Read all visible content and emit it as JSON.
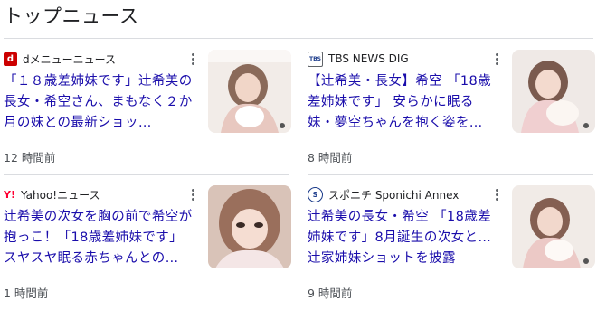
{
  "section": {
    "title": "トップニュース"
  },
  "colors": {
    "link": "#1a0dab",
    "meta": "#4d5156",
    "divider": "#dadce0"
  },
  "cards": [
    {
      "source": "dメニューニュース",
      "logo_text": "d",
      "logo_icon": "d-menu-logo-icon",
      "title": "「１８歳差姉妹です」辻希美の長女・希空さん、まもなく２か月の妹との最新ショッ…",
      "time": "12 時間前"
    },
    {
      "source": "TBS NEWS DIG",
      "logo_text": "TBS",
      "logo_icon": "tbs-logo-icon",
      "title": "【辻希美・長女】希空 「18歳差姉妹です」 安らかに眠る妹・夢空ちゃんを抱く姿を…",
      "time": "8 時間前"
    },
    {
      "source": "Yahoo!ニュース",
      "logo_text": "Y!",
      "logo_icon": "yahoo-logo-icon",
      "title": "辻希美の次女を胸の前で希空が抱っこ！「18歳差姉妹です」スヤスヤ眠る赤ちゃんとの…",
      "time": "1 時間前"
    },
    {
      "source": "スポニチ Sponichi Annex",
      "logo_text": "S",
      "logo_icon": "sponichi-logo-icon",
      "title": "辻希美の長女・希空 「18歳差姉妹です」8月誕生の次女と…辻家姉妹ショットを披露",
      "time": "9 時間前"
    }
  ]
}
